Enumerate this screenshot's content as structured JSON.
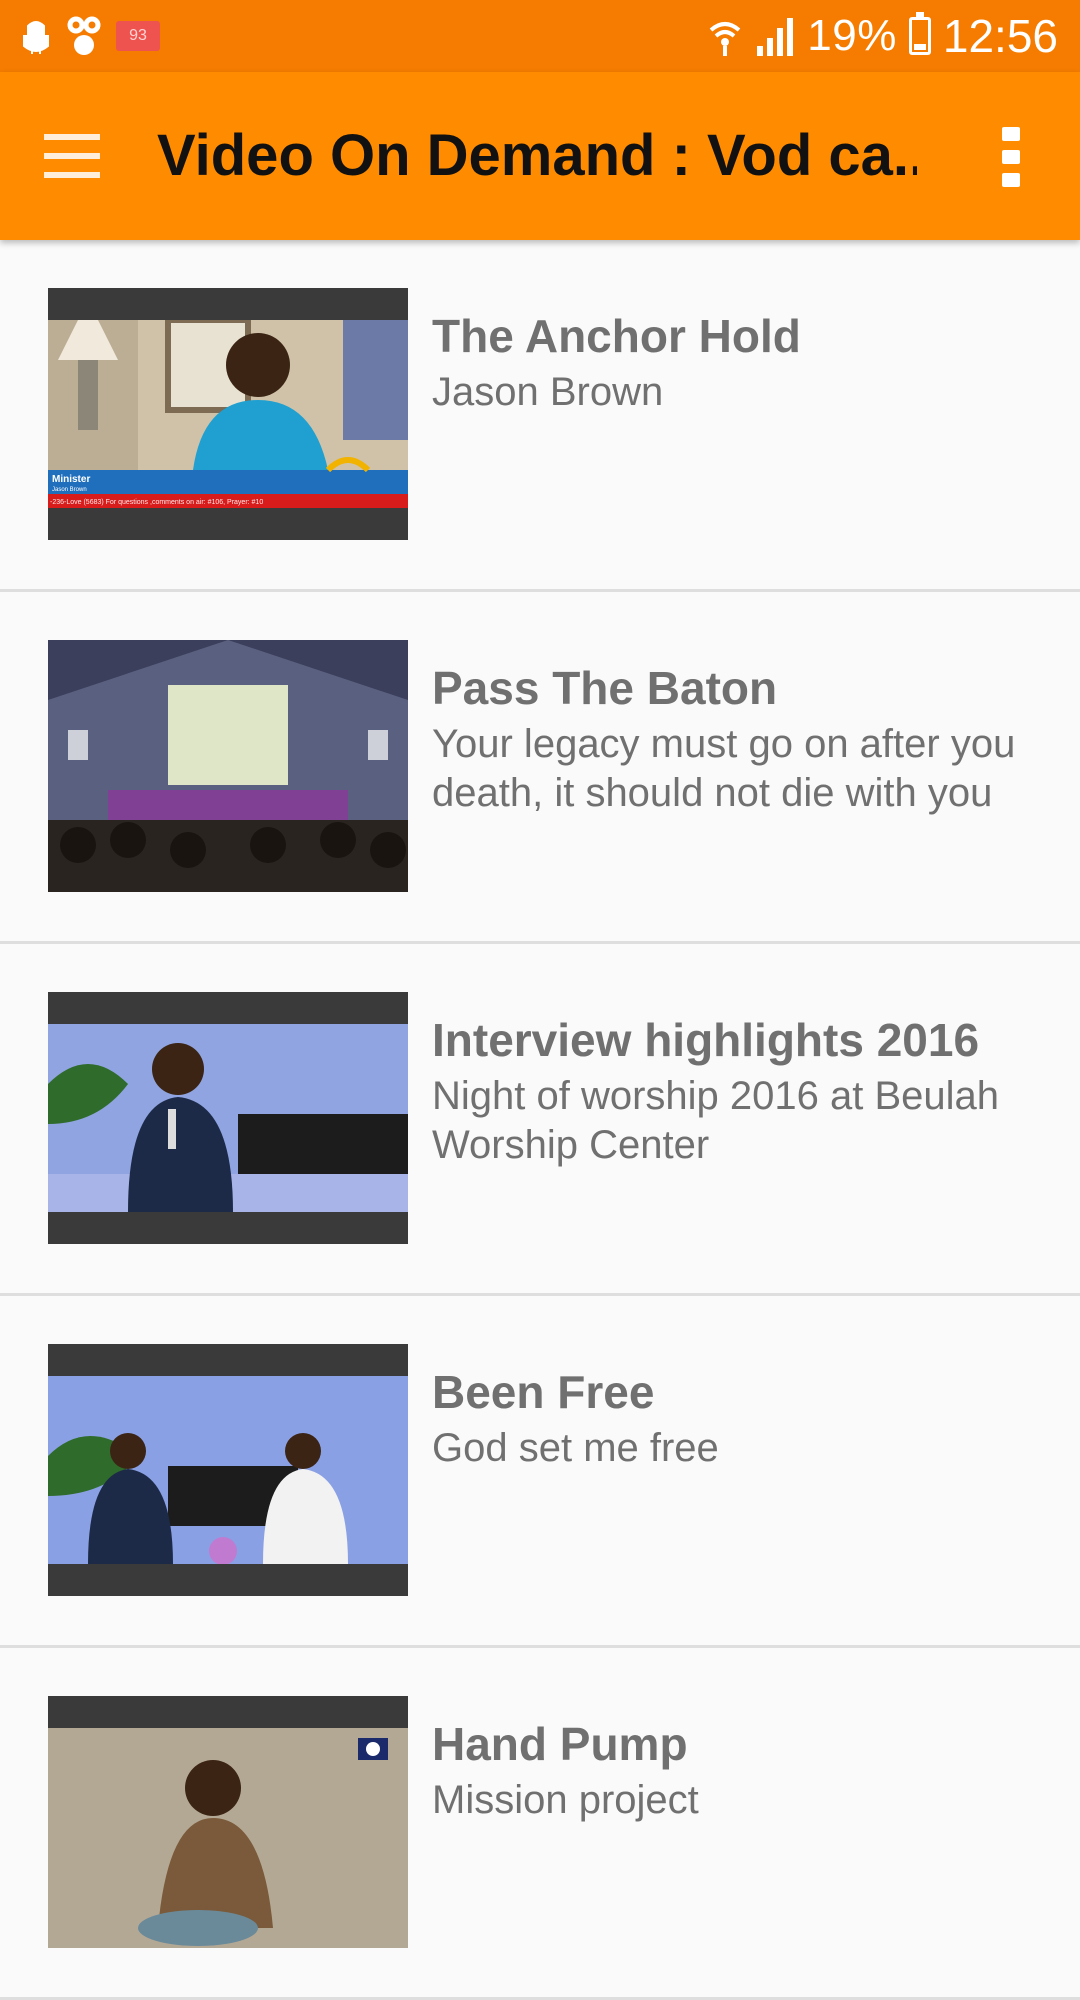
{
  "status_bar": {
    "notification_badge": "93",
    "battery_percent": "19%",
    "battery_level": 0.19,
    "time": "12:56",
    "icons": [
      "android-debug-icon",
      "usb-icon",
      "notification-badge",
      "wifi-icon",
      "signal-icon",
      "battery-icon"
    ]
  },
  "app_bar": {
    "title": "Video On Demand : Vod ca...",
    "menu_icon": "hamburger-menu-icon",
    "overflow_icon": "more-vert-icon",
    "background": "#ff8c00",
    "status_background": "#f57c00"
  },
  "videos": [
    {
      "title": "The Anchor Hold",
      "subtitle": "Jason Brown"
    },
    {
      "title": "Pass The Baton",
      "subtitle": "Your legacy must go on after you death, it should not die with you"
    },
    {
      "title": "Interview highlights 2016",
      "subtitle": "Night of worship 2016 at Beulah Worship Center"
    },
    {
      "title": "Been Free",
      "subtitle": "God set me free"
    },
    {
      "title": "Hand Pump",
      "subtitle": "Mission project"
    }
  ],
  "thumbnail_overlay": {
    "name_label_role": "Minister",
    "name_label_name": "Jason Brown",
    "ticker": "-236-Love (5683) For questions ,comments on air: #106, Prayer: #10"
  }
}
